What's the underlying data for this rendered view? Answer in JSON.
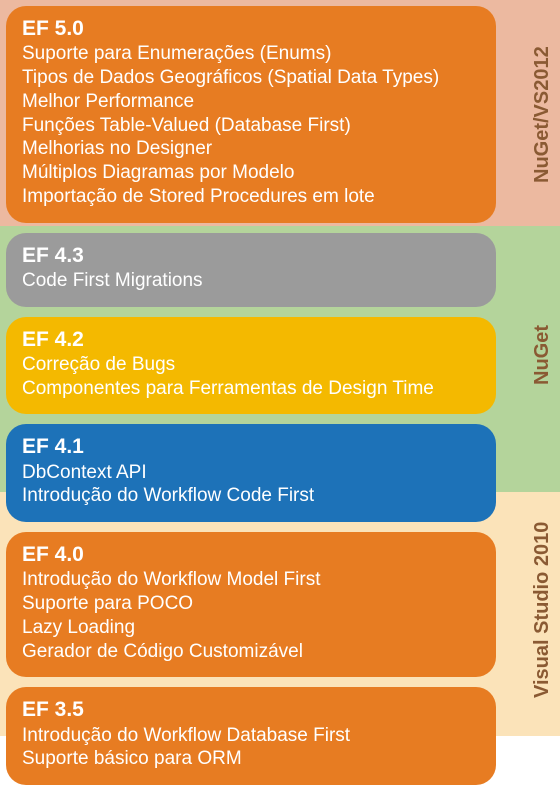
{
  "sections": [
    {
      "label": "NuGet/VS2012",
      "bg": "#ecb9a0"
    },
    {
      "label": "NuGet",
      "bg": "#b4d49b"
    },
    {
      "label": "Visual Studio 2010",
      "bg": "#fbe3b9"
    }
  ],
  "cards": [
    {
      "color": "orange",
      "title": "EF 5.0",
      "features": [
        "Suporte para Enumerações (Enums)",
        "Tipos de Dados Geográficos (Spatial Data Types)",
        "Melhor Performance",
        "Funções Table-Valued (Database First)",
        "Melhorias no Designer",
        "Múltiplos Diagramas por Modelo",
        "Importação de Stored Procedures em lote"
      ]
    },
    {
      "color": "gray",
      "title": "EF 4.3",
      "features": [
        "Code First Migrations"
      ]
    },
    {
      "color": "yellow",
      "title": "EF 4.2",
      "features": [
        "Correção de Bugs",
        "Componentes para Ferramentas de Design Time"
      ]
    },
    {
      "color": "blue",
      "title": "EF 4.1",
      "features": [
        "DbContext API",
        "Introdução do Workflow Code First"
      ]
    },
    {
      "color": "orange",
      "title": "EF 4.0",
      "features": [
        "Introdução do Workflow Model First",
        "Suporte para POCO",
        "Lazy Loading",
        "Gerador de Código Customizável"
      ]
    },
    {
      "color": "orange",
      "title": "EF 3.5",
      "features": [
        "Introdução do Workflow Database First",
        "Suporte básico para ORM"
      ]
    }
  ]
}
